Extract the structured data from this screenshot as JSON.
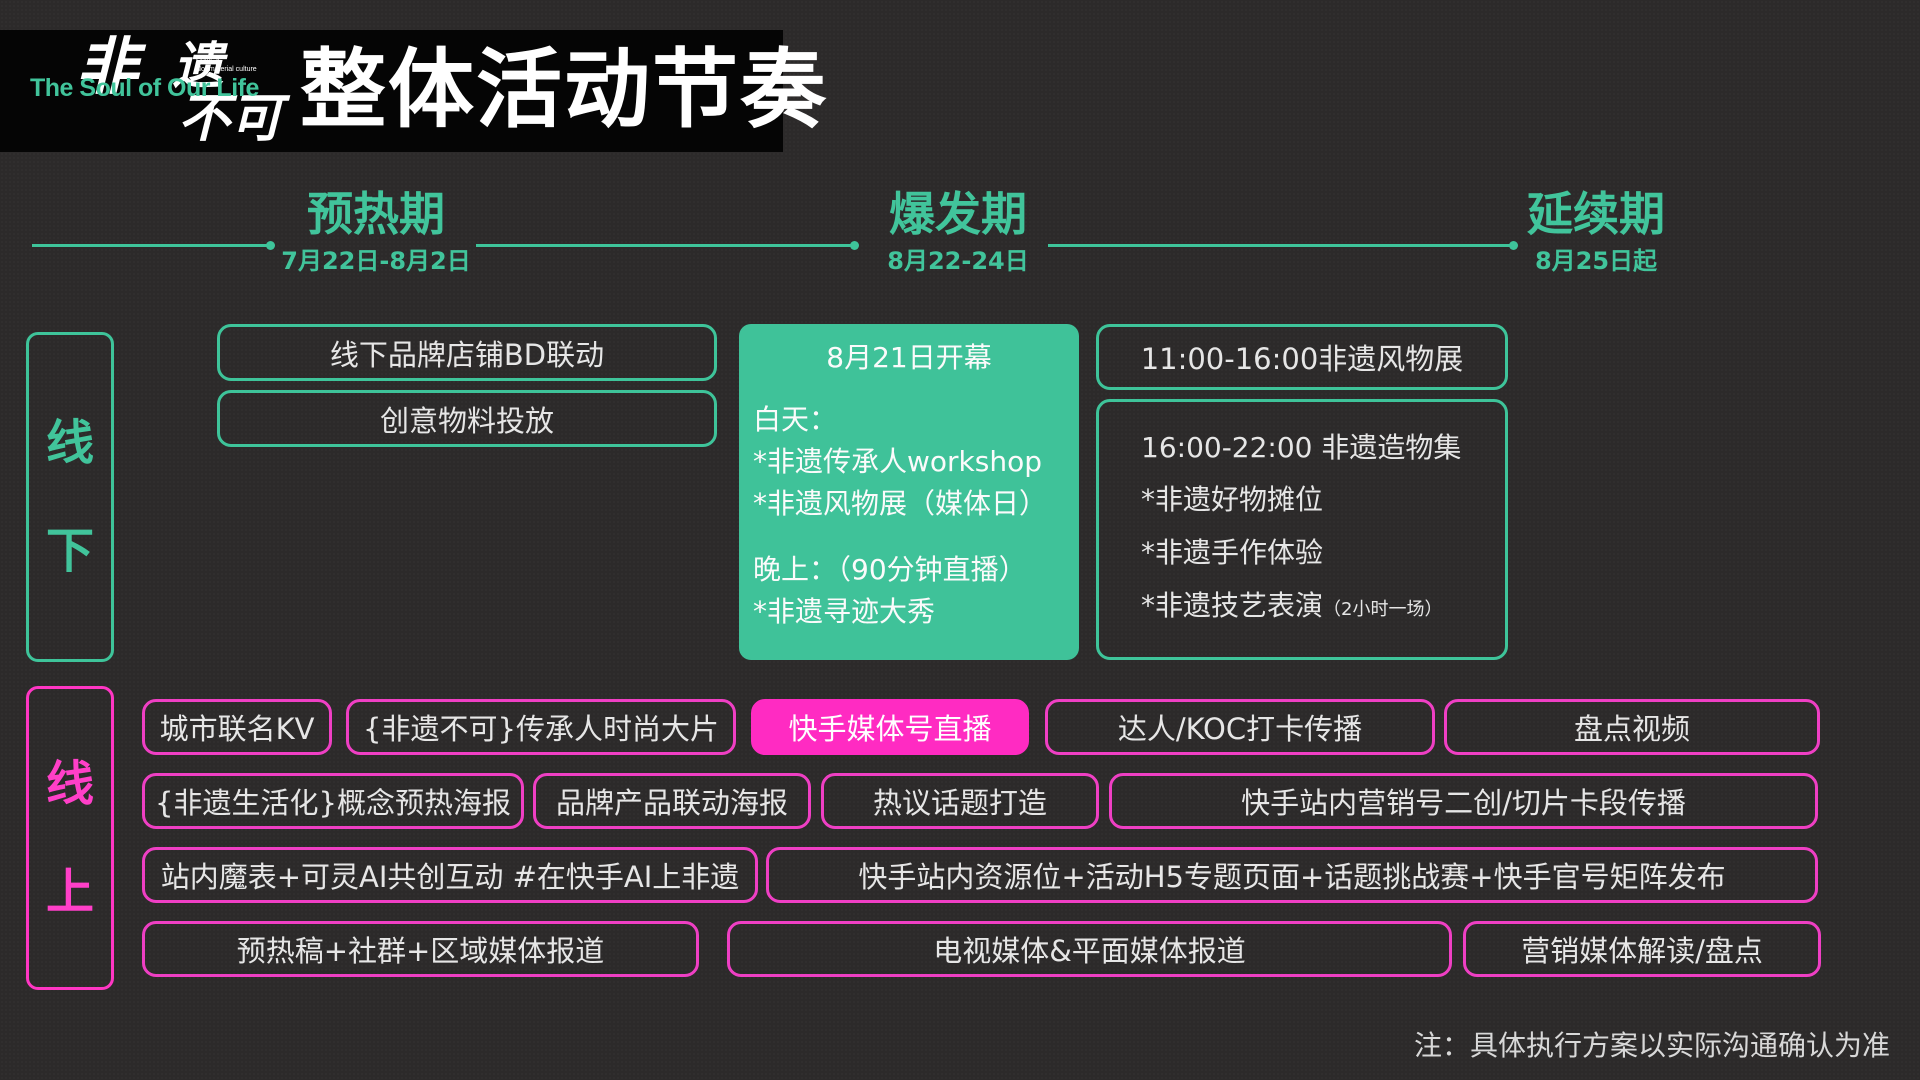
{
  "logo": {
    "zh_1": "非",
    "zh_2": "遗",
    "zh_3": "不可",
    "en": "The Soul of Our Life",
    "tag_1": "Chinese",
    "tag_2": "Nonmaterial culture"
  },
  "title": "整体活动节奏",
  "phases": [
    {
      "name": "预热期",
      "date": "7月22日-8月2日"
    },
    {
      "name": "爆发期",
      "date": "8月22-24日"
    },
    {
      "name": "延续期",
      "date": "8月25日起"
    }
  ],
  "sections": {
    "offline": [
      "线",
      "下"
    ],
    "online": [
      "线",
      "上"
    ]
  },
  "offline": {
    "warmup": [
      "线下品牌店铺BD联动",
      "创意物料投放"
    ],
    "burst": {
      "opening": "8月21日开幕",
      "day_label": "白天：",
      "day_items": [
        "*非遗传承人workshop",
        "*非遗风物展（媒体日）"
      ],
      "night_label": "晚上：（90分钟直播）",
      "night_items": [
        "*非遗寻迹大秀"
      ]
    },
    "exhibition": "11:00-16:00非遗风物展",
    "market": {
      "title": "16:00-22:00 非遗造物集",
      "items": [
        "*非遗好物摊位",
        "*非遗手作体验",
        "*非遗技艺表演"
      ],
      "note": "（2小时一场）"
    }
  },
  "online": {
    "row1": [
      "城市联名KV",
      "{非遗不可}传承人时尚大片",
      "快手媒体号直播",
      "达人/KOC打卡传播",
      "盘点视频"
    ],
    "row2": [
      "{非遗生活化}概念预热海报",
      "品牌产品联动海报",
      "热议话题打造",
      "快手站内营销号二创/切片卡段传播"
    ],
    "row3": [
      "站内魔表+可灵AI共创互动 #在快手AI上非遗",
      "快手站内资源位+活动H5专题页面+话题挑战赛+快手官号矩阵发布"
    ],
    "row4": [
      "预热稿+社群+区域媒体报道",
      "电视媒体&平面媒体报道",
      "营销媒体解读/盘点"
    ]
  },
  "footnote": "注：具体执行方案以实际沟通确认为准",
  "colors": {
    "green": "#3ec49a",
    "pink": "#ff2bc2",
    "background": "#2c2a2a"
  }
}
